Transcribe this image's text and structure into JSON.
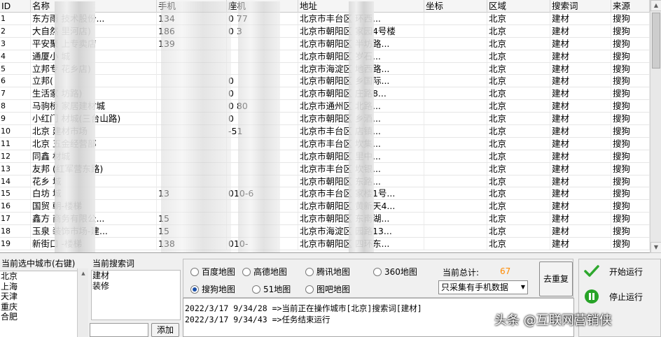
{
  "columns": [
    "ID",
    "名称",
    "手机",
    "座机",
    "地址",
    "坐标",
    "区域",
    "搜索词",
    "来源"
  ],
  "rows": [
    {
      "id": "1",
      "name": "东方雨",
      "name2": "技术股份...",
      "mobile": "134",
      "landline": "0",
      "landline2": "77",
      "address": "北京市丰台区",
      "address2": "环西...",
      "coord": "",
      "area": "北京",
      "keyword": "建材",
      "source": "搜狗"
    },
    {
      "id": "2",
      "name": "大自然",
      "name2": "里河店)",
      "mobile": "186",
      "landline": "0",
      "landline2": "3",
      "address": "北京市朝阳区",
      "address2": "家园4号楼",
      "coord": "",
      "area": "北京",
      "keyword": "建材",
      "source": "搜狗"
    },
    {
      "id": "3",
      "name": "平安聚",
      "name2": "上专卖店",
      "mobile": "139",
      "landline": "",
      "landline2": "",
      "address": "北京市朝阳区",
      "address2": "半坊路...",
      "coord": "",
      "area": "北京",
      "keyword": "建材",
      "source": "搜狗"
    },
    {
      "id": "4",
      "name": "通厦小",
      "name2": "城",
      "mobile": "",
      "landline": "",
      "landline2": "",
      "address": "北京市朝阳区",
      "address2": "岁石...",
      "coord": "",
      "area": "北京",
      "keyword": "建材",
      "source": "搜狗"
    },
    {
      "id": "5",
      "name": "立邦专",
      "name2": "花乡店)",
      "mobile": "",
      "landline": "",
      "landline2": "",
      "address": "北京市海淀区",
      "address2": "地西路...",
      "coord": "",
      "area": "北京",
      "keyword": "建材",
      "source": "搜狗"
    },
    {
      "id": "6",
      "name": "立邦(",
      "name2": "",
      "mobile": "",
      "landline": "0",
      "landline2": "",
      "address": "北京市朝阳区",
      "address2": "乡国际...",
      "coord": "",
      "area": "北京",
      "keyword": "建材",
      "source": "搜狗"
    },
    {
      "id": "7",
      "name": "生活家",
      "name2": "坊路)",
      "mobile": "",
      "landline": "0",
      "landline2": "",
      "address": "北京市朝阳区",
      "address2": "庄路8...",
      "coord": "",
      "area": "北京",
      "keyword": "建材",
      "source": "搜狗"
    },
    {
      "id": "8",
      "name": "马驹桥",
      "name2": "家居建材城",
      "mobile": "",
      "landline": "0",
      "landline2": "80",
      "address": "北京市通州区",
      "address2": "北路...",
      "coord": "",
      "area": "北京",
      "keyword": "建材",
      "source": "搜狗"
    },
    {
      "id": "9",
      "name": "小红门",
      "name2": "材城(三台山路)",
      "mobile": "",
      "landline": "0",
      "landline2": "",
      "address": "北京市朝阳区",
      "address2": "乡酒...",
      "coord": "",
      "area": "北京",
      "keyword": "建材",
      "source": "搜狗"
    },
    {
      "id": "10",
      "name": "北京",
      "name2": "建材市场",
      "mobile": "",
      "landline": "",
      "landline2": "-51",
      "address": "北京市丰台区",
      "address2": "店镇...",
      "coord": "",
      "area": "北京",
      "keyword": "建材",
      "source": "搜狗"
    },
    {
      "id": "11",
      "name": "北京",
      "name2": "五金经营部",
      "mobile": "",
      "landline": "",
      "landline2": "",
      "address": "北京市丰台区",
      "address2": "坎集...",
      "coord": "",
      "area": "北京",
      "keyword": "建材",
      "source": "搜狗"
    },
    {
      "id": "12",
      "name": "同鑫",
      "name2": "材城",
      "mobile": "",
      "landline": "",
      "landline2": "",
      "address": "北京市朝阳区",
      "address2": "里中...",
      "coord": "",
      "area": "北京",
      "keyword": "建材",
      "source": "搜狗"
    },
    {
      "id": "13",
      "name": "友邦",
      "name2": "(红军营东路)",
      "mobile": "",
      "landline": "",
      "landline2": "",
      "address": "北京市丰台区",
      "address2": "坎银...",
      "coord": "",
      "area": "北京",
      "keyword": "建材",
      "source": "搜狗"
    },
    {
      "id": "14",
      "name": "花乡",
      "name2": "城",
      "mobile": "",
      "landline": "",
      "landline2": "",
      "address": "北京市朝阳区",
      "address2": "东路...",
      "coord": "",
      "area": "北京",
      "keyword": "建材",
      "source": "搜狗"
    },
    {
      "id": "15",
      "name": "白坊",
      "name2": "城",
      "mobile": "13",
      "landline": "010-6",
      "landline2": "",
      "address": "北京市丰台区",
      "address2": "家楼1号...",
      "coord": "",
      "area": "北京",
      "keyword": "建材",
      "source": "搜狗"
    },
    {
      "id": "16",
      "name": "国贸",
      "name2": "朝-楼梯",
      "mobile": "",
      "landline": "",
      "landline2": "",
      "address": "北京市朝阳区",
      "address2": "黄新天4...",
      "coord": "",
      "area": "北京",
      "keyword": "建材",
      "source": "搜狗"
    },
    {
      "id": "17",
      "name": "鑫方",
      "name2": "商务有限公...",
      "mobile": "15",
      "landline": "",
      "landline2": "",
      "address": "北京市朝阳区",
      "address2": "东南湖...",
      "coord": "",
      "area": "北京",
      "keyword": "建材",
      "source": "搜狗"
    },
    {
      "id": "18",
      "name": "玉泉",
      "name2": "装饰市场-建...",
      "mobile": "15",
      "landline": "",
      "landline2": "",
      "address": "北京市海淀区",
      "address2": "园路13...",
      "coord": "",
      "area": "北京",
      "keyword": "建材",
      "source": "搜狗"
    },
    {
      "id": "19",
      "name": "新街口",
      "name2": "-楼梯",
      "mobile": "138",
      "landline": "010-",
      "landline2": "",
      "address": "北京市朝阳区",
      "address2": "四环东...",
      "coord": "",
      "area": "北京",
      "keyword": "建材",
      "source": "搜狗"
    }
  ],
  "cities_panel": {
    "title": "当前选中城市(右键)",
    "items": [
      "北京",
      "上海",
      "天津",
      "重庆",
      "合肥"
    ]
  },
  "keywords_panel": {
    "title": "当前搜索词",
    "items": [
      "建材",
      "装修"
    ],
    "input_value": "",
    "add_label": "添加"
  },
  "maps": {
    "options": [
      "百度地图",
      "高德地图",
      "腾讯地图",
      "360地图",
      "搜狗地图",
      "51地图",
      "图吧地图"
    ],
    "selected": "搜狗地图"
  },
  "stats": {
    "total_label": "当前总计:",
    "total_value": "67",
    "filter_value": "只采集有手机数据"
  },
  "dedupe_label": "去重复",
  "start_label": "开始运行",
  "stop_label": "停止运行",
  "log": [
    "2022/3/17  9/34/28 =>当前正在操作城市[北京]搜索词[建材]",
    "2022/3/17  9/34/43 =>任务结束运行"
  ],
  "watermark": "头条 @互联网营销侠",
  "colors": {
    "total_value": "#ff8a00",
    "start_icon": "#2ea82e",
    "stop_icon": "#27a327"
  }
}
